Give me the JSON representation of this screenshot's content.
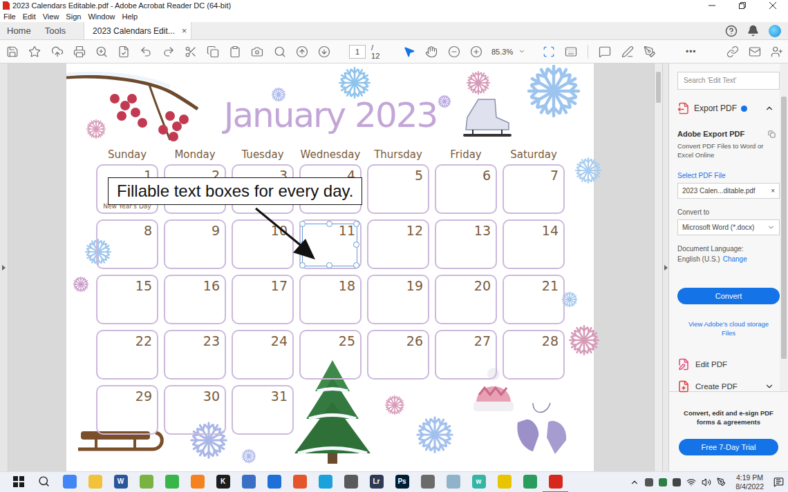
{
  "window": {
    "title": "2023 Calendars Editable.pdf - Adobe Acrobat Reader DC (64-bit)"
  },
  "menu": [
    "File",
    "Edit",
    "View",
    "Sign",
    "Window",
    "Help"
  ],
  "nav": [
    {
      "label": "Home",
      "selected": false
    },
    {
      "label": "Tools",
      "selected": false
    }
  ],
  "document_tab": {
    "label": "2023 Calendars Edit...",
    "close": "×",
    "selected": true
  },
  "toolbar": {
    "page_current": "1",
    "page_total": "/ 12",
    "zoom": "85.3%",
    "more": "•••"
  },
  "calendar": {
    "title": "January 2023",
    "weekdays": [
      "Sunday",
      "Monday",
      "Tuesday",
      "Wednesday",
      "Thursday",
      "Friday",
      "Saturday"
    ],
    "weeks": [
      [
        {
          "day": "1",
          "note": "New Year's Day",
          "selected": false
        },
        {
          "day": "2",
          "selected": false
        },
        {
          "day": "3",
          "selected": false
        },
        {
          "day": "4",
          "selected": false
        },
        {
          "day": "5",
          "selected": false
        },
        {
          "day": "6",
          "selected": false
        },
        {
          "day": "7",
          "selected": false
        }
      ],
      [
        {
          "day": "8",
          "selected": false
        },
        {
          "day": "9",
          "selected": false
        },
        {
          "day": "10",
          "selected": false
        },
        {
          "day": "11",
          "selected": true
        },
        {
          "day": "12",
          "selected": false
        },
        {
          "day": "13",
          "selected": false
        },
        {
          "day": "14",
          "selected": false
        }
      ],
      [
        {
          "day": "15",
          "selected": false
        },
        {
          "day": "16",
          "selected": false
        },
        {
          "day": "17",
          "selected": false
        },
        {
          "day": "18",
          "selected": false
        },
        {
          "day": "19",
          "selected": false
        },
        {
          "day": "20",
          "selected": false
        },
        {
          "day": "21",
          "selected": false
        }
      ],
      [
        {
          "day": "22",
          "selected": false
        },
        {
          "day": "23",
          "selected": false
        },
        {
          "day": "24",
          "selected": false
        },
        {
          "day": "25",
          "selected": false
        },
        {
          "day": "26",
          "selected": false
        },
        {
          "day": "27",
          "selected": false
        },
        {
          "day": "28",
          "selected": false
        }
      ],
      [
        {
          "day": "29",
          "selected": false
        },
        {
          "day": "30",
          "selected": false
        },
        {
          "day": "31",
          "selected": false
        }
      ]
    ],
    "callout": "Fillable text boxes for every day."
  },
  "side_panel": {
    "search_placeholder": "Search 'Edit Text'",
    "section": {
      "title": "Export PDF",
      "expanded": true
    },
    "heading": "Adobe Export PDF",
    "description": "Convert PDF Files to Word or Excel Online",
    "select_label": "Select PDF File",
    "file_name": "2023 Calen...ditable.pdf",
    "clear": "×",
    "convert_to_label": "Convert to",
    "convert_to_value": "Microsoft Word (*.docx)",
    "language_label": "Document Language:",
    "language_value": "English (U.S.)",
    "language_change": "Change",
    "convert_button": "Convert",
    "cloud_link": "View Adobe's cloud storage Files",
    "tools": [
      {
        "label": "Edit PDF",
        "kind": "edit",
        "expandable": false
      },
      {
        "label": "Create PDF",
        "kind": "create",
        "expandable": true
      }
    ],
    "promo": "Convert, edit and e-sign PDF forms & agreements",
    "trial_button": "Free 7-Day Trial"
  },
  "taskbar": {
    "apps": [
      {
        "label": "",
        "color": "#4285f4",
        "active": false
      },
      {
        "label": "",
        "color": "#f2c23a",
        "active": false
      },
      {
        "label": "W",
        "color": "#2b579a",
        "active": false
      },
      {
        "label": "",
        "color": "#7bb342",
        "active": false
      },
      {
        "label": "",
        "color": "#39b54a",
        "active": false
      },
      {
        "label": "",
        "color": "#f58220",
        "active": false
      },
      {
        "label": "K",
        "color": "#1d1d1d",
        "active": false
      },
      {
        "label": "",
        "color": "#3b6fc6",
        "active": false
      },
      {
        "label": "",
        "color": "#1f6fd8",
        "active": false
      },
      {
        "label": "",
        "color": "#e4552b",
        "active": false
      },
      {
        "label": "",
        "color": "#1ba1dc",
        "active": false
      },
      {
        "label": "",
        "color": "#5a5a5a",
        "active": false
      },
      {
        "label": "Lr",
        "color": "#2f3b55",
        "active": false
      },
      {
        "label": "Ps",
        "color": "#001e36",
        "active": false
      },
      {
        "label": "",
        "color": "#6b6b6b",
        "active": false
      },
      {
        "label": "",
        "color": "#8fb3c9",
        "active": false
      },
      {
        "label": "w",
        "color": "#35b5a4",
        "active": false
      },
      {
        "label": "",
        "color": "#e9c400",
        "active": false
      },
      {
        "label": "",
        "color": "#2a9d5c",
        "active": false
      },
      {
        "label": "",
        "color": "#d7281e",
        "active": true
      }
    ],
    "time": "4:19 PM",
    "date": "8/4/2022"
  }
}
